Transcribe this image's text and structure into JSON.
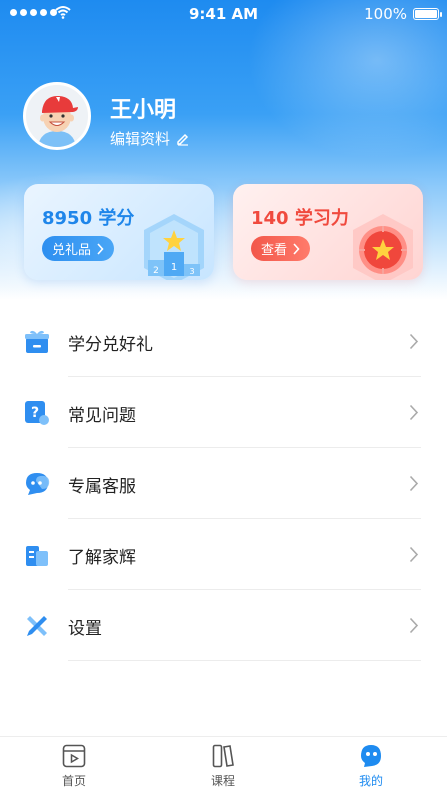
{
  "status_bar": {
    "time": "9:41 AM",
    "battery": "100%"
  },
  "profile": {
    "name": "王小明",
    "edit_label": "编辑资料"
  },
  "cards": [
    {
      "title": "8950 学分",
      "button": "兑礼品",
      "color": "#1f86ea"
    },
    {
      "title": "140 学习力",
      "button": "查看",
      "color": "#f04a3e"
    }
  ],
  "menu": [
    {
      "label": "学分兑好礼",
      "icon": "gift-box-icon"
    },
    {
      "label": "常见问题",
      "icon": "question-icon"
    },
    {
      "label": "专属客服",
      "icon": "chat-service-icon"
    },
    {
      "label": "了解家辉",
      "icon": "building-info-icon"
    },
    {
      "label": "设置",
      "icon": "settings-tools-icon"
    }
  ],
  "tabs": [
    {
      "label": "首页",
      "icon": "home-video-icon"
    },
    {
      "label": "课程",
      "icon": "course-books-icon"
    },
    {
      "label": "我的",
      "icon": "mine-face-icon",
      "active": true
    }
  ],
  "colors": {
    "accent": "#1e8bf0",
    "red": "#f04a3e"
  }
}
